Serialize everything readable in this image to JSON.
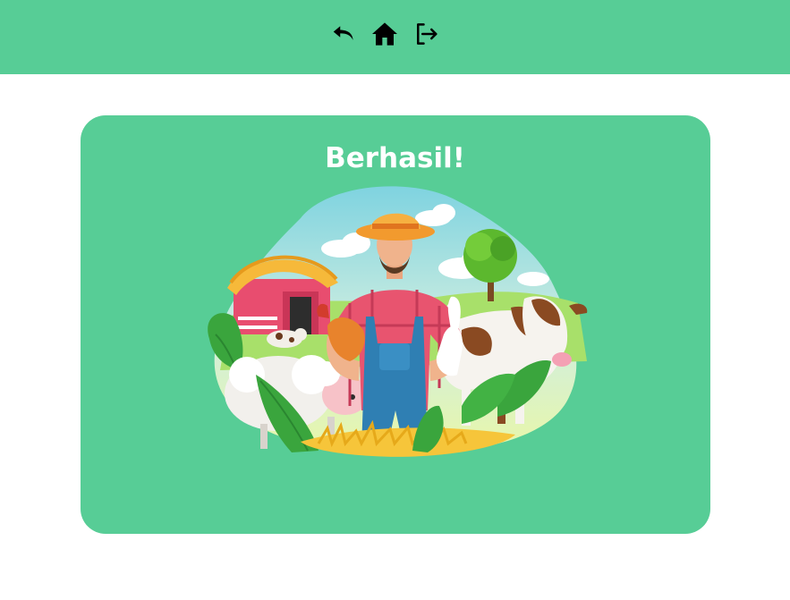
{
  "nav": {
    "icons": [
      "undo-icon",
      "home-icon",
      "logout-icon"
    ]
  },
  "colors": {
    "accent": "#57cd96",
    "background": "#ffffff",
    "title_text": "#ffffff",
    "icon": "#000000"
  },
  "card": {
    "title": "Berhasil!",
    "illustration": "farmer-with-farm-animals"
  }
}
